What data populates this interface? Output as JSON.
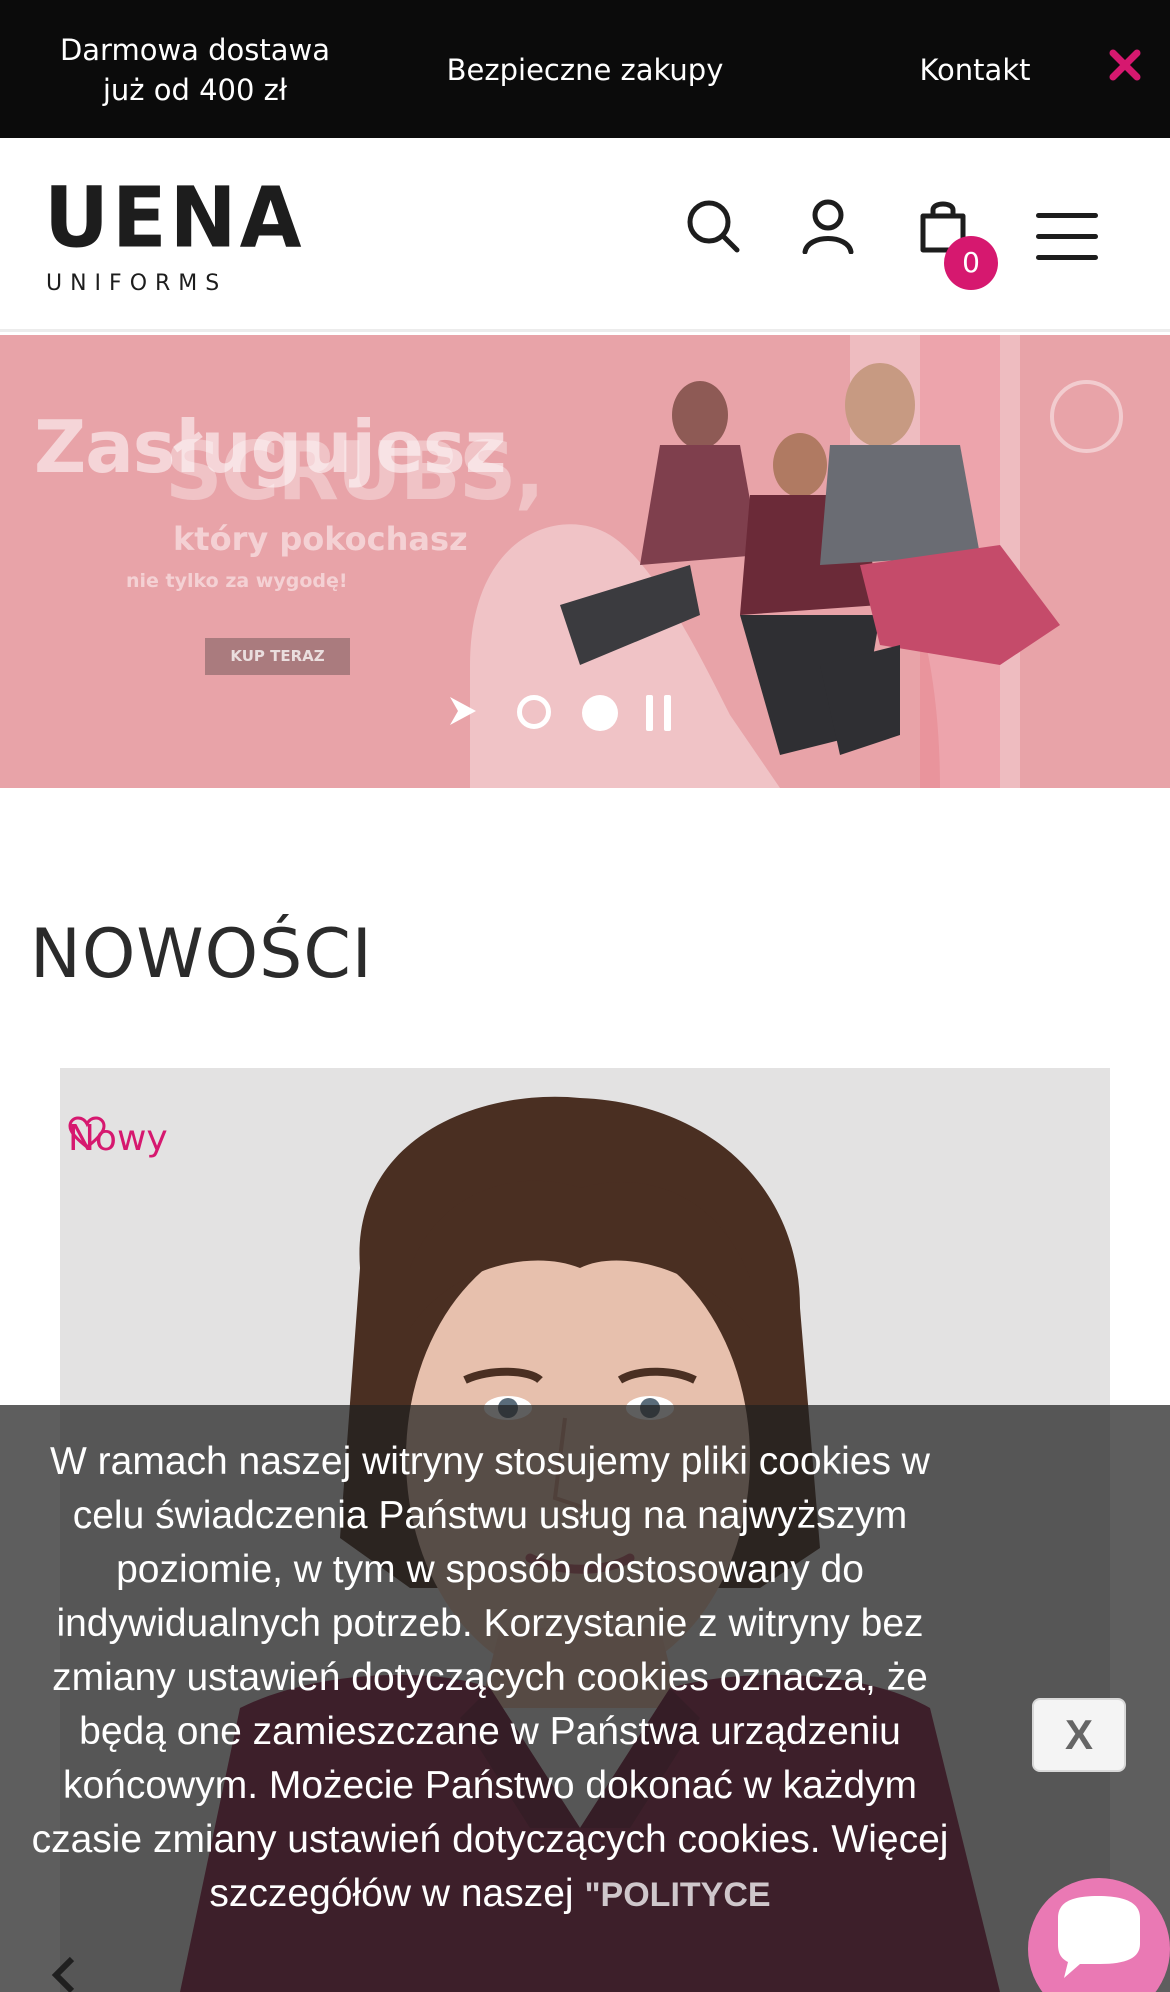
{
  "topbar": {
    "delivery_text": "Darmowa dostawa już od 400 zł",
    "secure_text": "Bezpieczne zakupy",
    "contact_text": "Kontakt",
    "close_icon": "close-icon"
  },
  "header": {
    "logo_mark": "UENA",
    "logo_sub": "UNIFORMS",
    "cart_count": "0",
    "icons": [
      "search-icon",
      "user-icon",
      "bag-icon",
      "hamburger-menu-icon"
    ]
  },
  "hero": {
    "headline_1": "Zasługujesz",
    "headline_2": "SCRUBS,",
    "subline": "który pokochasz",
    "tagline": "nie tylko za wygodę!",
    "cta_label": "KUP TERAZ",
    "slides_total": 2,
    "active_slide": 2
  },
  "section": {
    "title": "NOWOŚCI"
  },
  "product": {
    "badge": "Nowy"
  },
  "cookie": {
    "text": "W ramach naszej witryny stosujemy pliki cookies w celu świadczenia Państwu usług na najwyższym poziomie, w tym w sposób dostosowany do indywidualnych potrzeb. Korzystanie z witryny bez zmiany ustawień dotyczących cookies oznacza, że będą one zamieszczane w Państwa urządzeniu końcowym. Możecie Państwo dokonać w każdym czasie zmiany ustawień dotyczących cookies. Więcej szczegółów w naszej",
    "policy_link": "\"POLITYCE",
    "close_label": "X"
  },
  "colors": {
    "accent": "#d6186f",
    "topbar_bg": "#0b0b0b",
    "hero_bg": "#e8a3a8"
  }
}
